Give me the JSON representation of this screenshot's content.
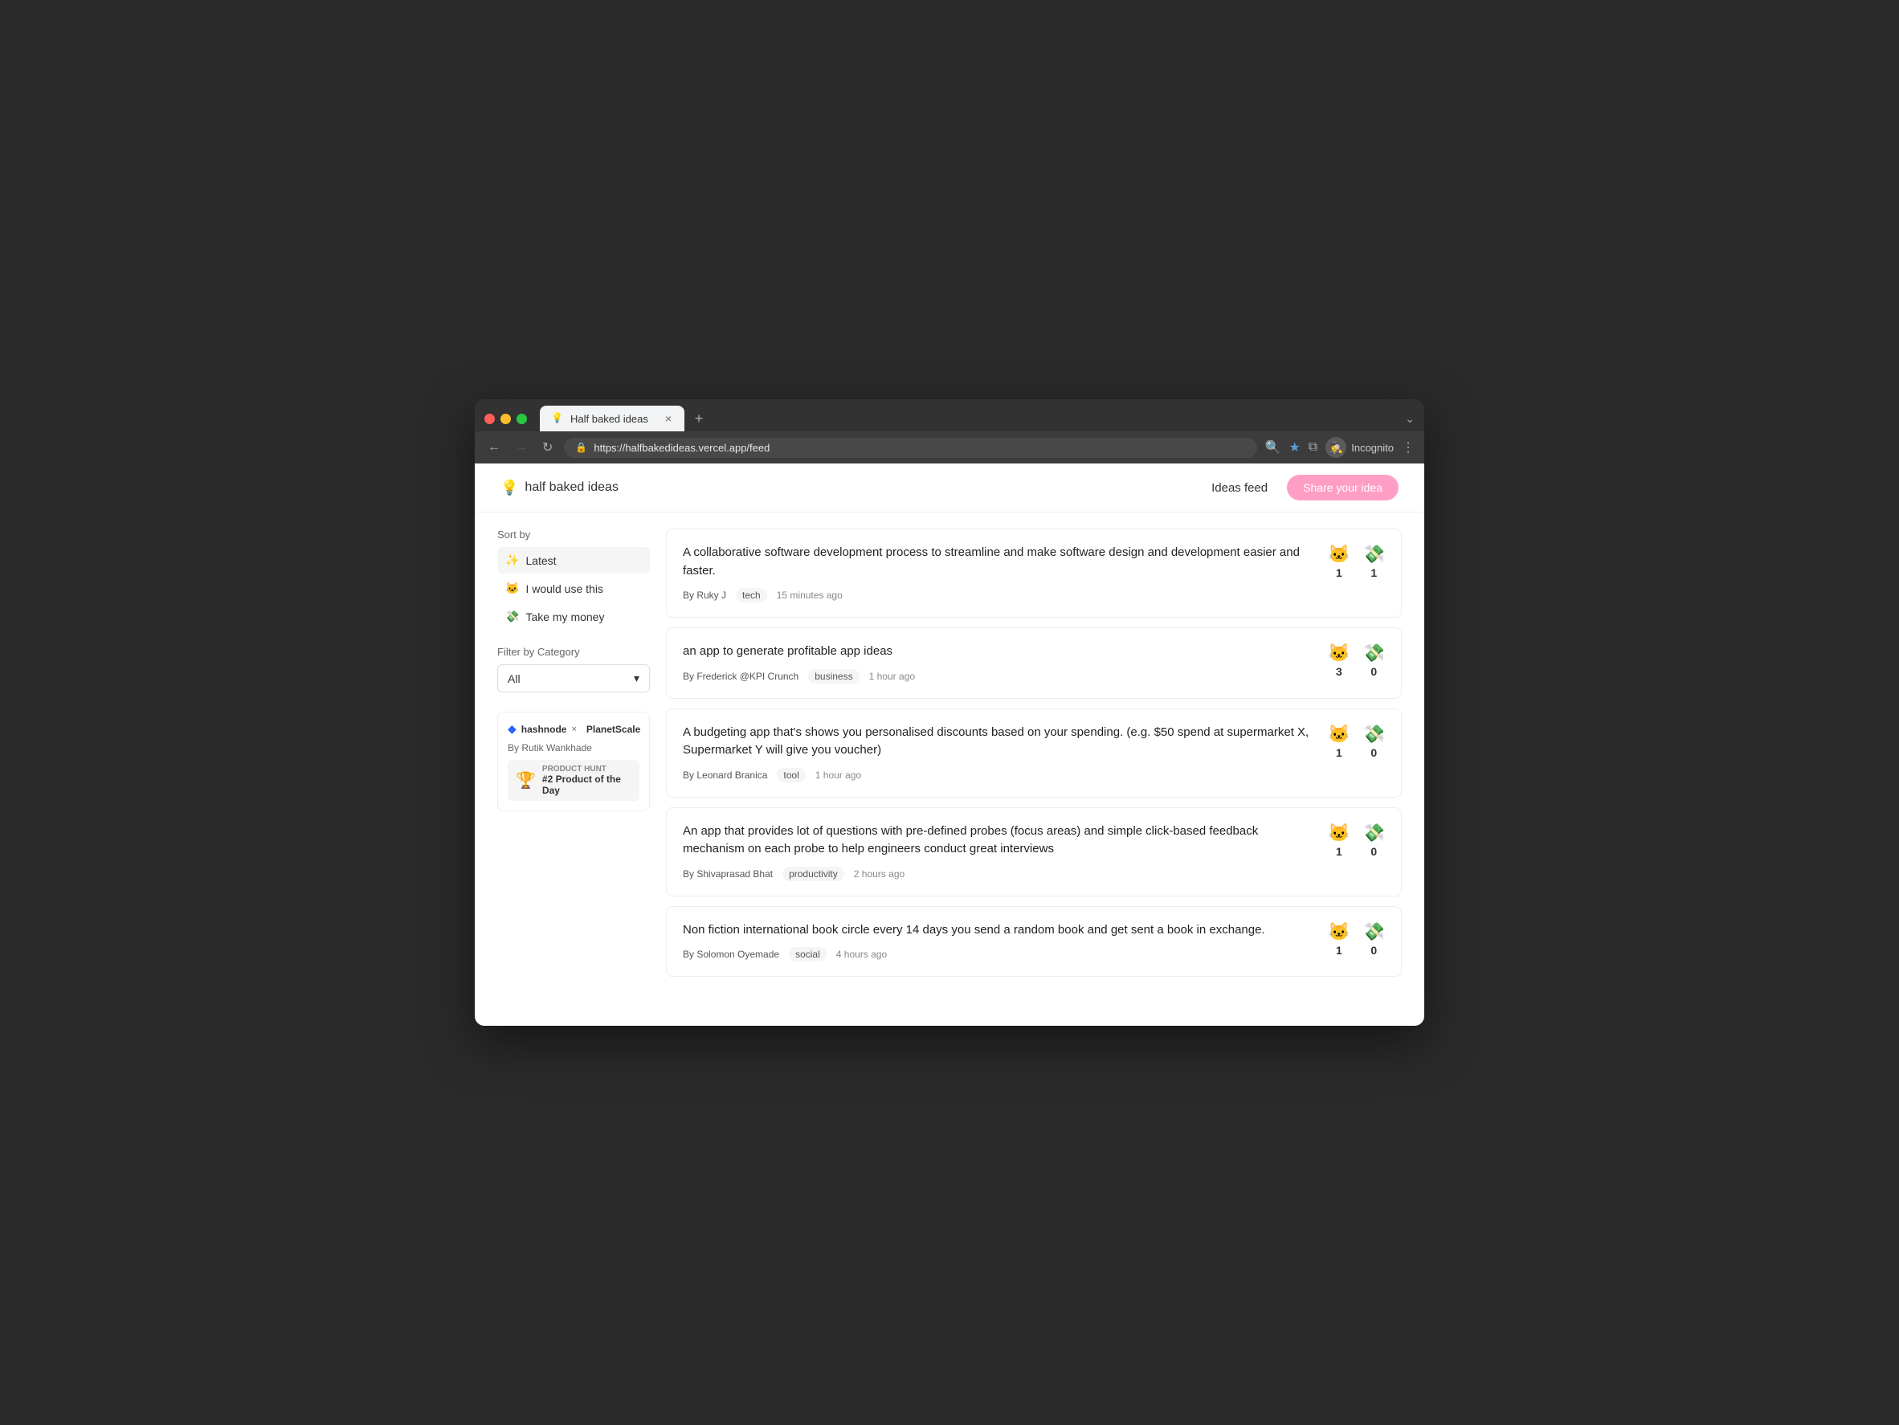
{
  "browser": {
    "tab_favicon": "💡",
    "tab_title": "Half baked ideas",
    "tab_close": "×",
    "tab_new": "+",
    "tab_more": "⌄",
    "nav_back": "←",
    "nav_forward": "→",
    "nav_reload": "↻",
    "url_lock": "🔒",
    "url": "https://halfbakedideas.vercel.app/feed",
    "search_icon": "🔍",
    "star_icon": "★",
    "extensions_icon": "⧉",
    "incognito_label": "Incognito",
    "more_icon": "⋮"
  },
  "app": {
    "logo_emoji": "💡",
    "logo_text": "half baked ideas",
    "nav_ideas_feed": "Ideas feed",
    "share_button": "Share your idea"
  },
  "sidebar": {
    "sort_label": "Sort by",
    "sort_options": [
      {
        "emoji": "✨",
        "label": "Latest",
        "active": true
      },
      {
        "emoji": "🐱",
        "label": "I would use this",
        "active": false
      },
      {
        "emoji": "💸",
        "label": "Take my money",
        "active": false
      }
    ],
    "filter_label": "Filter by Category",
    "category_value": "All",
    "category_arrow": "▾",
    "promo": {
      "hashnode_icon": "◆",
      "hashnode_text": "hashnode",
      "x_text": "×",
      "planetscale_text": "PlanetScale",
      "author": "By Rutik Wankhade",
      "ph_trophy": "🏆",
      "ph_label": "PRODUCT HUNT",
      "ph_rank": "#2 Product of the Day"
    }
  },
  "ideas": [
    {
      "title": "A collaborative software development process to streamline and make software design and development easier and faster.",
      "author": "Ruky J",
      "category": "tech",
      "time": "15 minutes ago",
      "cat_votes": 1,
      "money_votes": 1
    },
    {
      "title": "an app to generate profitable app ideas",
      "author": "Frederick @KPI Crunch",
      "category": "business",
      "time": "1 hour ago",
      "cat_votes": 3,
      "money_votes": 0
    },
    {
      "title": "A budgeting app that's shows you personalised discounts based on your spending. (e.g. $50 spend at supermarket X, Supermarket Y will give you voucher)",
      "author": "Leonard Branica",
      "category": "tool",
      "time": "1 hour ago",
      "cat_votes": 1,
      "money_votes": 0
    },
    {
      "title": "An app that provides lot of questions with pre-defined probes (focus areas) and simple click-based feedback mechanism on each probe to help engineers conduct great interviews",
      "author": "Shivaprasad Bhat",
      "category": "productivity",
      "time": "2 hours ago",
      "cat_votes": 1,
      "money_votes": 0
    },
    {
      "title": "Non fiction international book circle every 14 days you send a random book and get sent a book in exchange.",
      "author": "Solomon Oyemade",
      "category": "social",
      "time": "4 hours ago",
      "cat_votes": 1,
      "money_votes": 0
    }
  ],
  "vote_emojis": {
    "cat": "🐱",
    "money": "💸"
  }
}
